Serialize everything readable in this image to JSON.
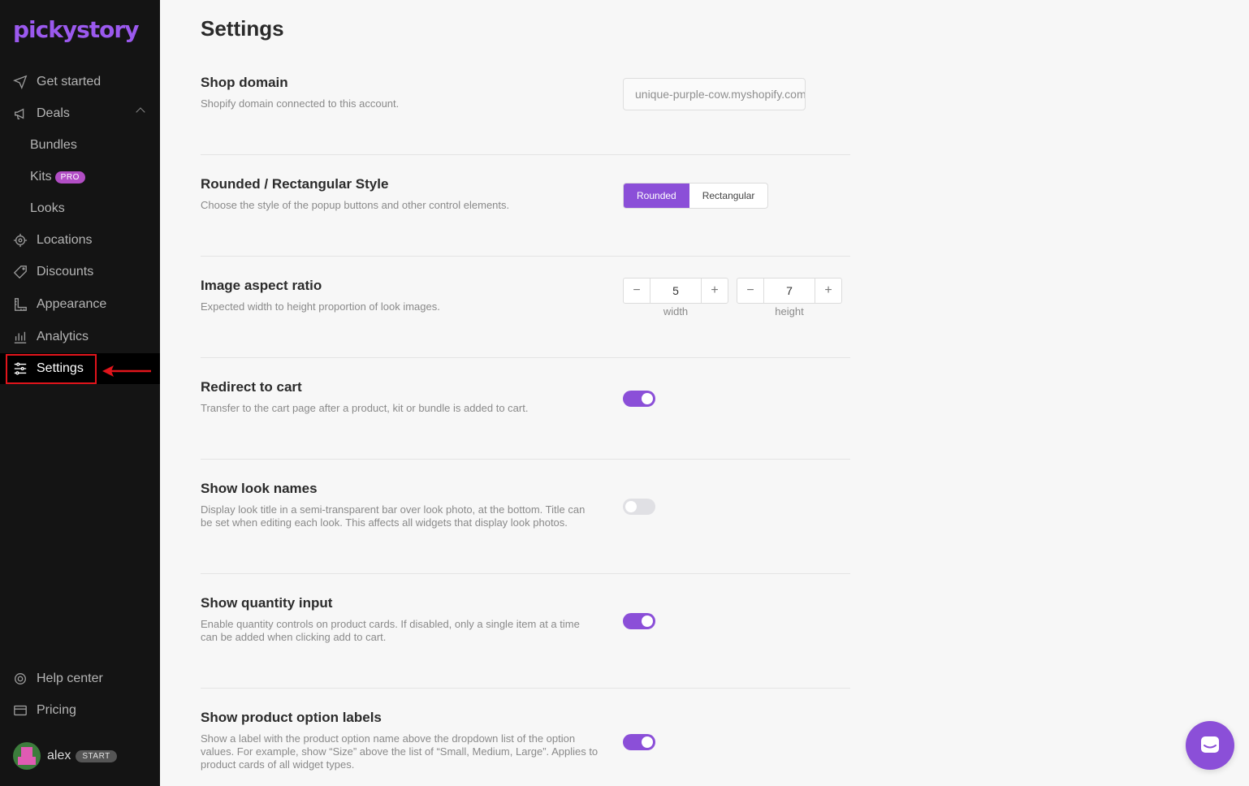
{
  "app": {
    "logo_text": "pickystory"
  },
  "sidebar": {
    "items": [
      {
        "label": "Get started",
        "icon": "send-icon"
      },
      {
        "label": "Deals",
        "icon": "megaphone-icon"
      },
      {
        "label": "Bundles"
      },
      {
        "label": "Kits",
        "badge": "PRO"
      },
      {
        "label": "Looks"
      },
      {
        "label": "Locations",
        "icon": "target-icon"
      },
      {
        "label": "Discounts",
        "icon": "tag-icon"
      },
      {
        "label": "Appearance",
        "icon": "ruler-icon"
      },
      {
        "label": "Analytics",
        "icon": "bars-icon"
      },
      {
        "label": "Settings",
        "icon": "sliders-icon"
      }
    ],
    "footer": [
      {
        "label": "Help center",
        "icon": "lifebuoy-icon"
      },
      {
        "label": "Pricing",
        "icon": "card-icon"
      }
    ],
    "user": {
      "name": "alex",
      "plan": "START"
    }
  },
  "main": {
    "title": "Settings",
    "shop_domain": {
      "title": "Shop domain",
      "desc": "Shopify domain connected to this account.",
      "value": "unique-purple-cow.myshopify.com"
    },
    "style": {
      "title": "Rounded / Rectangular Style",
      "desc": "Choose the style of the popup buttons and other control elements.",
      "options": [
        "Rounded",
        "Rectangular"
      ],
      "selected": "Rounded"
    },
    "aspect": {
      "title": "Image aspect ratio",
      "desc": "Expected width to height proportion of look images.",
      "width": "5",
      "height": "7",
      "width_label": "width",
      "height_label": "height"
    },
    "redirect": {
      "title": "Redirect to cart",
      "desc": "Transfer to the cart page after a product, kit or bundle is added to cart.",
      "enabled": true
    },
    "look_names": {
      "title": "Show look names",
      "desc": "Display look title in a semi-transparent bar over look photo, at the bottom. Title can be set when editing each look. This affects all widgets that display look photos.",
      "enabled": false
    },
    "quantity": {
      "title": "Show quantity input",
      "desc": "Enable quantity controls on product cards. If disabled, only a single item at a time can be added when clicking add to cart.",
      "enabled": true
    },
    "option_labels": {
      "title": "Show product option labels",
      "desc": "Show a label with the product option name above the dropdown list of the option values. For example, show “Size” above the list of “Small, Medium, Large”. Applies to product cards of all widget types.",
      "enabled": true
    }
  },
  "colors": {
    "accent": "#8b4fd8",
    "sidebar_bg": "#141414",
    "highlight": "#e1141b"
  }
}
